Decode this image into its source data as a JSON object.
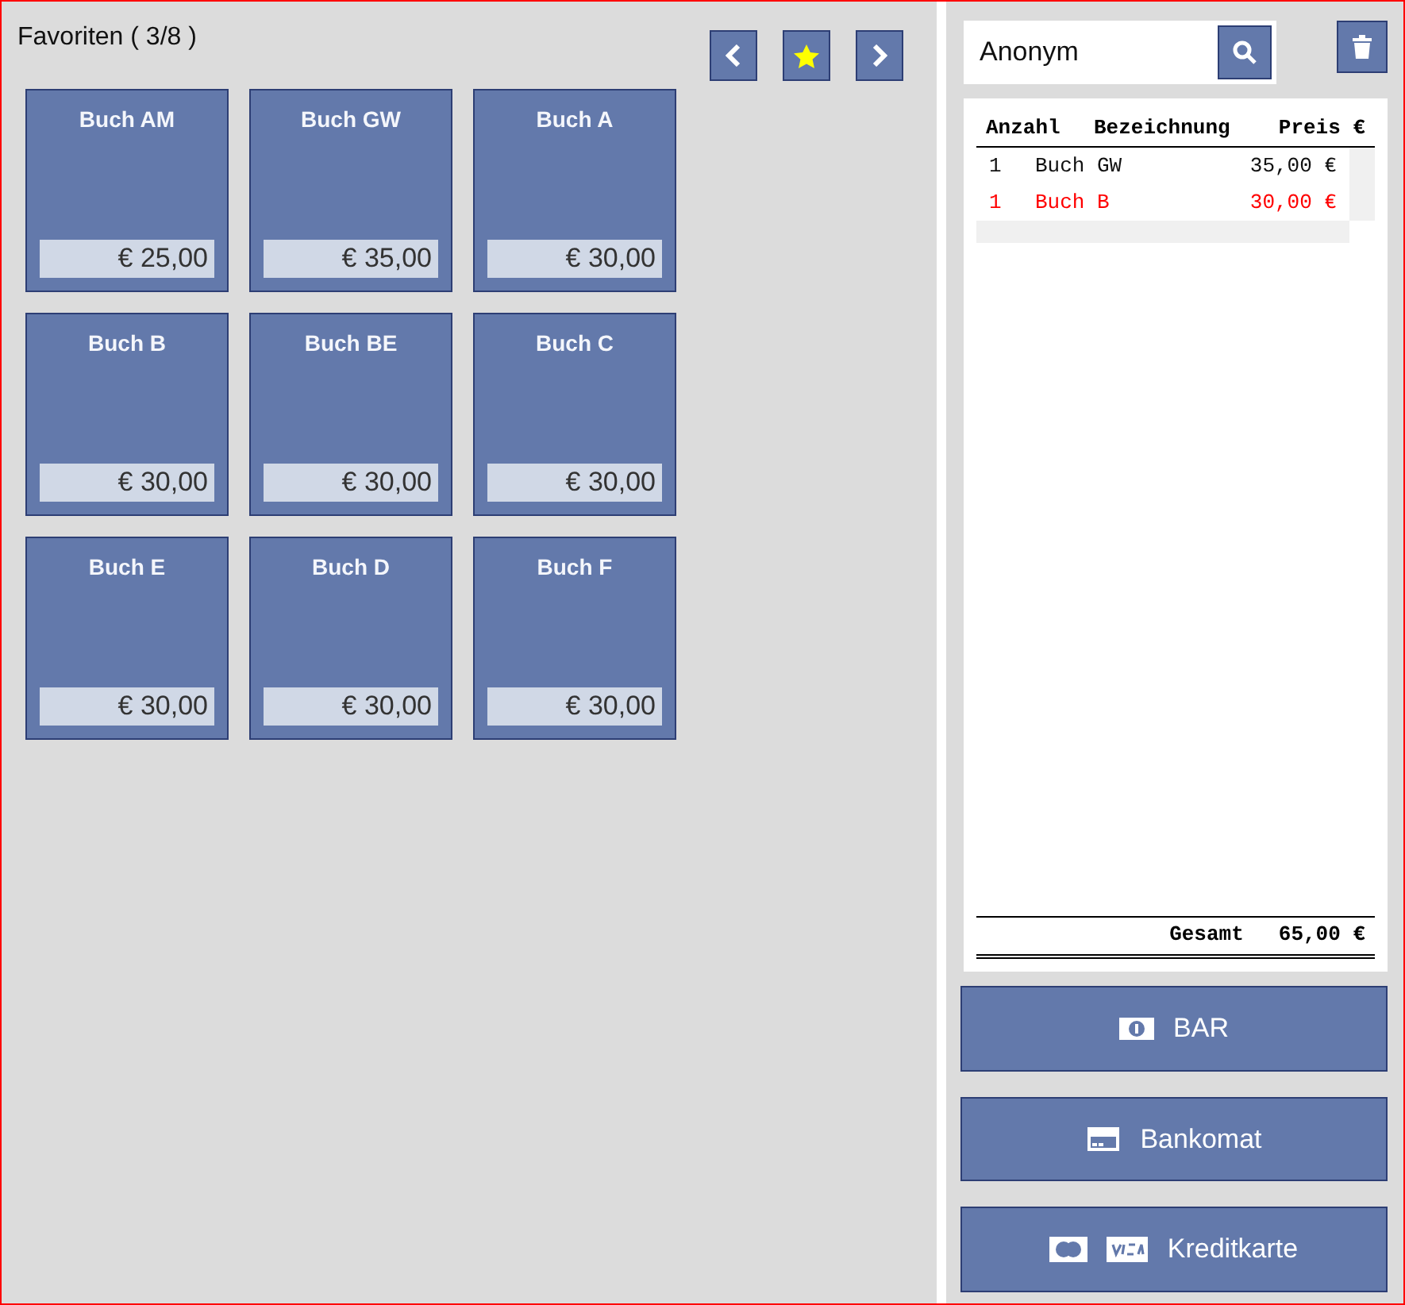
{
  "favorites": {
    "title": "Favoriten ( 3/8 )",
    "products": [
      {
        "name": "Buch AM",
        "price": "€ 25,00"
      },
      {
        "name": "Buch GW",
        "price": "€ 35,00"
      },
      {
        "name": "Buch A",
        "price": "€ 30,00"
      },
      {
        "name": "Buch B",
        "price": "€ 30,00"
      },
      {
        "name": "Buch BE",
        "price": "€ 30,00"
      },
      {
        "name": "Buch C",
        "price": "€ 30,00"
      },
      {
        "name": "Buch E",
        "price": "€ 30,00"
      },
      {
        "name": "Buch D",
        "price": "€ 30,00"
      },
      {
        "name": "Buch F",
        "price": "€ 30,00"
      }
    ]
  },
  "customer": {
    "value": "Anonym"
  },
  "receipt": {
    "columns": [
      "Anzahl",
      "Bezeichnung",
      "Preis €"
    ],
    "rows": [
      {
        "qty": "1",
        "name": "Buch GW",
        "price": "35,00 €",
        "highlighted": false
      },
      {
        "qty": "1",
        "name": "Buch B",
        "price": "30,00 €",
        "highlighted": true
      }
    ],
    "total_label": "Gesamt",
    "total": "65,00 €"
  },
  "payments": [
    {
      "kind": "cash",
      "label": "BAR"
    },
    {
      "kind": "debit",
      "label": "Bankomat"
    },
    {
      "kind": "credit",
      "label": "Kreditkarte"
    }
  ]
}
